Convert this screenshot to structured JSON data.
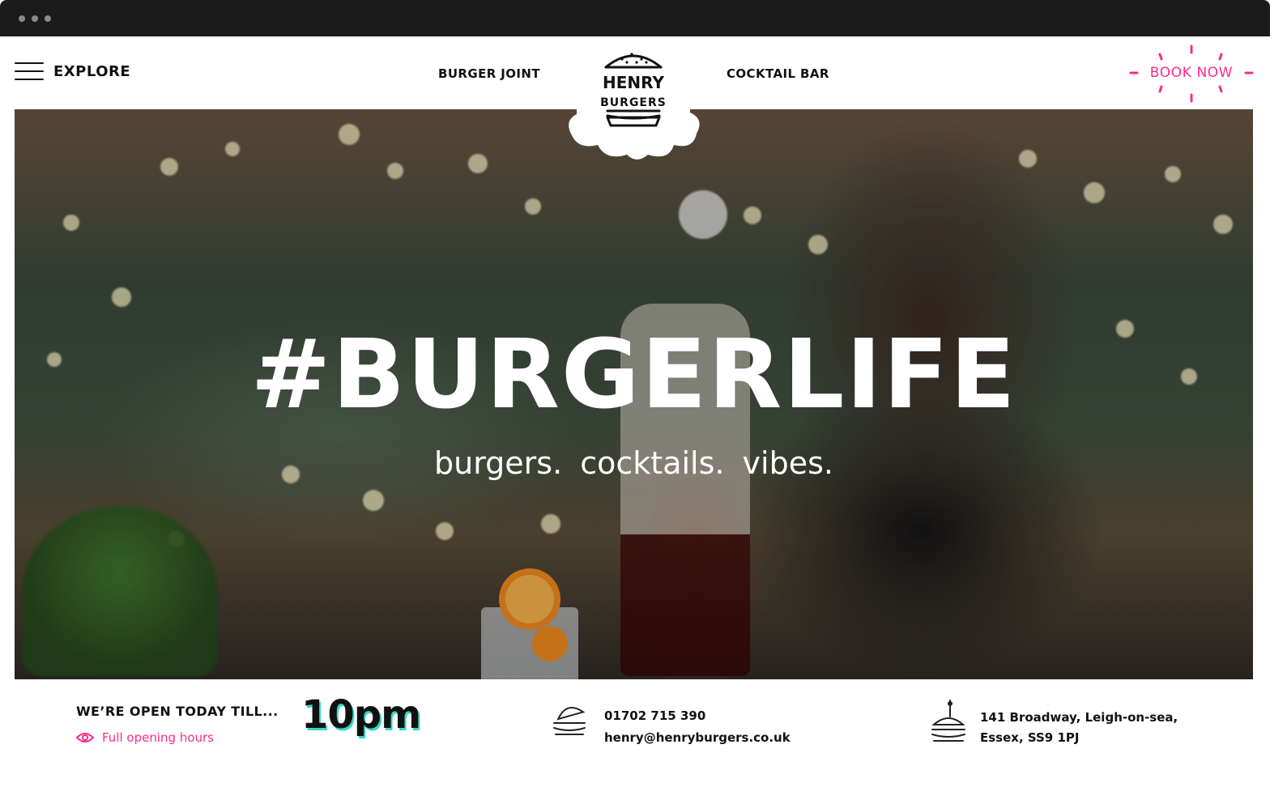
{
  "header": {
    "explore_label": "EXPLORE",
    "nav_left": "BURGER JOINT",
    "nav_right": "COCKTAIL BAR",
    "book_now": "BOOK NOW",
    "logo": {
      "line1": "HENRY",
      "line2": "BURGERS"
    }
  },
  "hero": {
    "title": "#BURGERLIFE",
    "subtitle": "burgers.  cocktails.  vibes."
  },
  "info": {
    "open_label": "WE’RE OPEN TODAY TILL...",
    "opening_hours_link": "Full opening hours",
    "open_time": "10pm",
    "phone": "01702 715 390",
    "email": "henry@henryburgers.co.uk",
    "address_line1": "141 Broadway, Leigh-on-sea,",
    "address_line2": "Essex, SS9 1PJ"
  },
  "colors": {
    "accent_pink": "#ff2a8a",
    "accent_teal": "#33d8c6",
    "text_dark": "#111111"
  },
  "icons": [
    "menu-icon",
    "eye-icon",
    "burger-contact-icon",
    "burger-location-icon"
  ]
}
